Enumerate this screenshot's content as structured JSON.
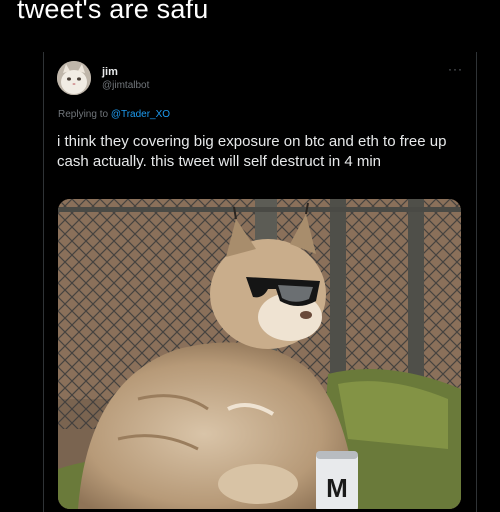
{
  "caption": "tweet's are safu",
  "tweet": {
    "author_name": "jim",
    "author_handle": "@jimtalbot",
    "more_icon": "more-dots-icon",
    "replying_prefix": "Replying to",
    "replying_to": "@Trader_XO",
    "text": "i think they covering big exposure on btc and eth to free up cash actually. this tweet will self destruct in 4 min"
  },
  "media": {
    "description_icon": "lynx-with-sunglasses-photo",
    "can_label": "M"
  },
  "colors": {
    "background": "#000000",
    "text": "#e7e9ea",
    "muted": "#71767b",
    "link": "#1d9bf0"
  }
}
